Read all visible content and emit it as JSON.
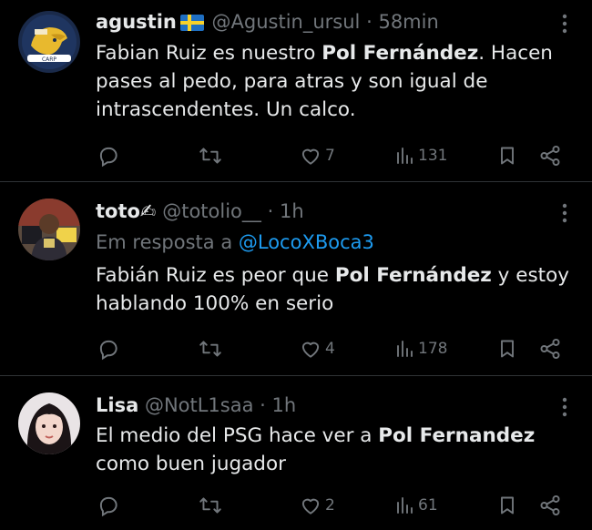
{
  "tweets": [
    {
      "name": "agustin",
      "handle": "@Agustin_ursul",
      "sep": "·",
      "time": "58min",
      "reply_prefix": "",
      "reply_link": "",
      "body": [
        {
          "t": "Fabian Ruiz es nuestro ",
          "b": false
        },
        {
          "t": "Pol Fernández",
          "b": true
        },
        {
          "t": ". Hacen pases al pedo, para atras y son igual de intrascendentes. Un calco.",
          "b": false
        }
      ],
      "likes": "7",
      "views": "131",
      "avatar": "cartoon-avatar"
    },
    {
      "name": "toto✍",
      "handle": "@totolio__",
      "sep": "·",
      "time": "1h",
      "reply_prefix": "Em resposta a ",
      "reply_link": "@LocoXBoca3",
      "body": [
        {
          "t": "Fabián Ruiz es peor que ",
          "b": false
        },
        {
          "t": "Pol Fernández",
          "b": true
        },
        {
          "t": " y estoy hablando 100% en serio",
          "b": false
        }
      ],
      "likes": "4",
      "views": "178",
      "avatar": "photo-avatar"
    },
    {
      "name": "Lisa",
      "handle": "@NotL1saa",
      "sep": "·",
      "time": "1h",
      "reply_prefix": "",
      "reply_link": "",
      "body": [
        {
          "t": "El medio del PSG hace ver a ",
          "b": false
        },
        {
          "t": "Pol Fernandez",
          "b": true
        },
        {
          "t": " como buen jugador",
          "b": false
        }
      ],
      "likes": "2",
      "views": "61",
      "avatar": "photo-avatar"
    }
  ],
  "colors": {
    "background": "#000000",
    "text": "#e7e9ea",
    "muted": "#71767b",
    "link": "#1d9bf0",
    "divider": "#2f3336"
  },
  "icons": {
    "reply": "reply-icon",
    "retweet": "retweet-icon",
    "like": "heart-icon",
    "views": "views-icon",
    "bookmark": "bookmark-icon",
    "share": "share-icon",
    "more": "more-dots-icon",
    "flag": "sweden-flag-icon"
  }
}
